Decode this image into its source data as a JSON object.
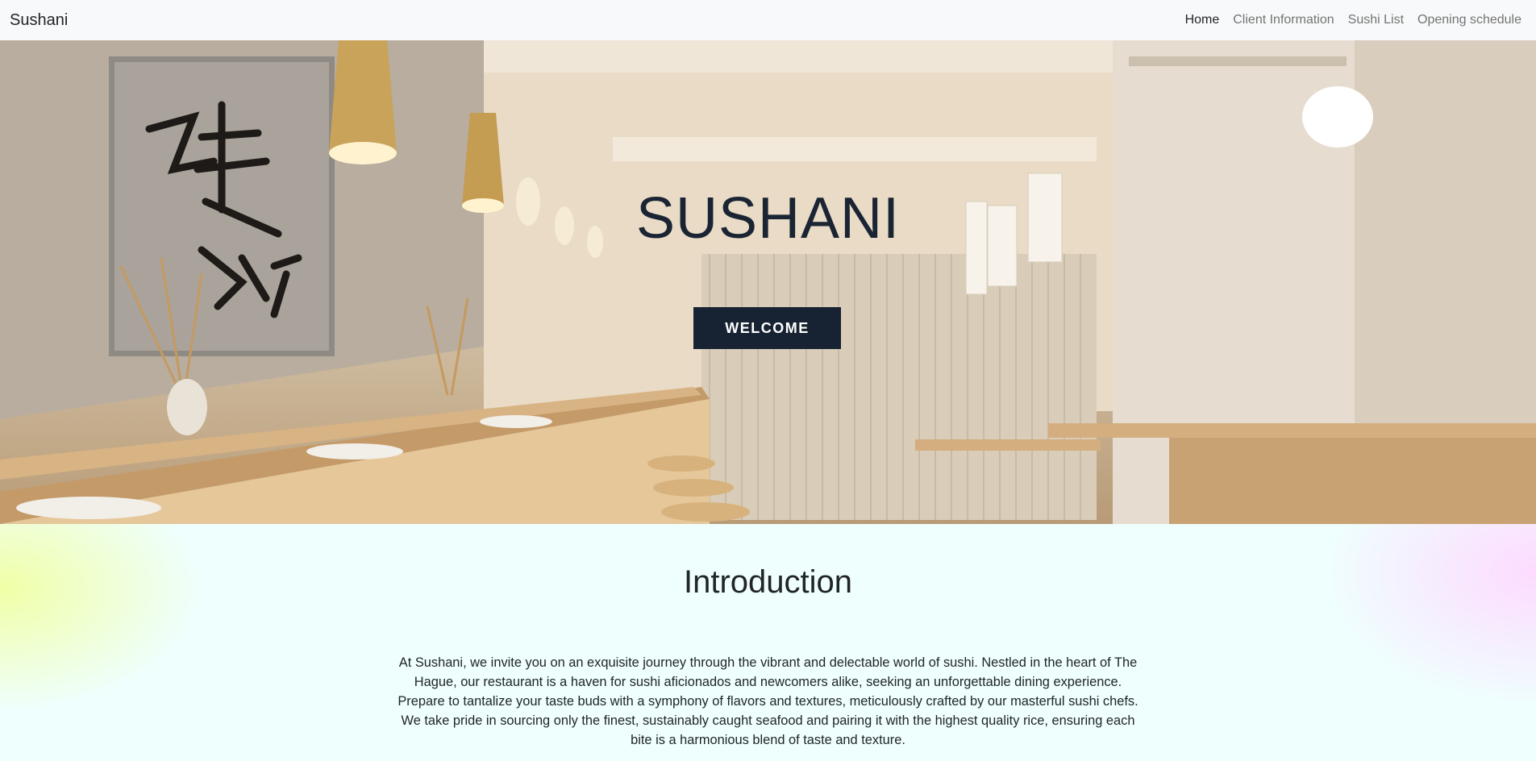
{
  "navbar": {
    "brand": "Sushani",
    "links": [
      {
        "label": "Home",
        "active": true
      },
      {
        "label": "Client Information",
        "active": false
      },
      {
        "label": "Sushi List",
        "active": false
      },
      {
        "label": "Opening schedule",
        "active": false
      }
    ]
  },
  "hero": {
    "title": "SUSHANI",
    "button_label": "WELCOME"
  },
  "intro": {
    "heading": "Introduction",
    "body": "At Sushani, we invite you on an exquisite journey through the vibrant and delectable world of sushi. Nestled in the heart of The Hague, our restaurant is a haven for sushi aficionados and newcomers alike, seeking an unforgettable dining experience. Prepare to tantalize your taste buds with a symphony of flavors and textures, meticulously crafted by our masterful sushi chefs. We take pride in sourcing only the finest, sustainably caught seafood and pairing it with the highest quality rice, ensuring each bite is a harmonious blend of taste and texture."
  },
  "colors": {
    "navbar_bg": "#f8f9fa",
    "hero_title": "#1a2433",
    "button_bg": "#172232"
  }
}
